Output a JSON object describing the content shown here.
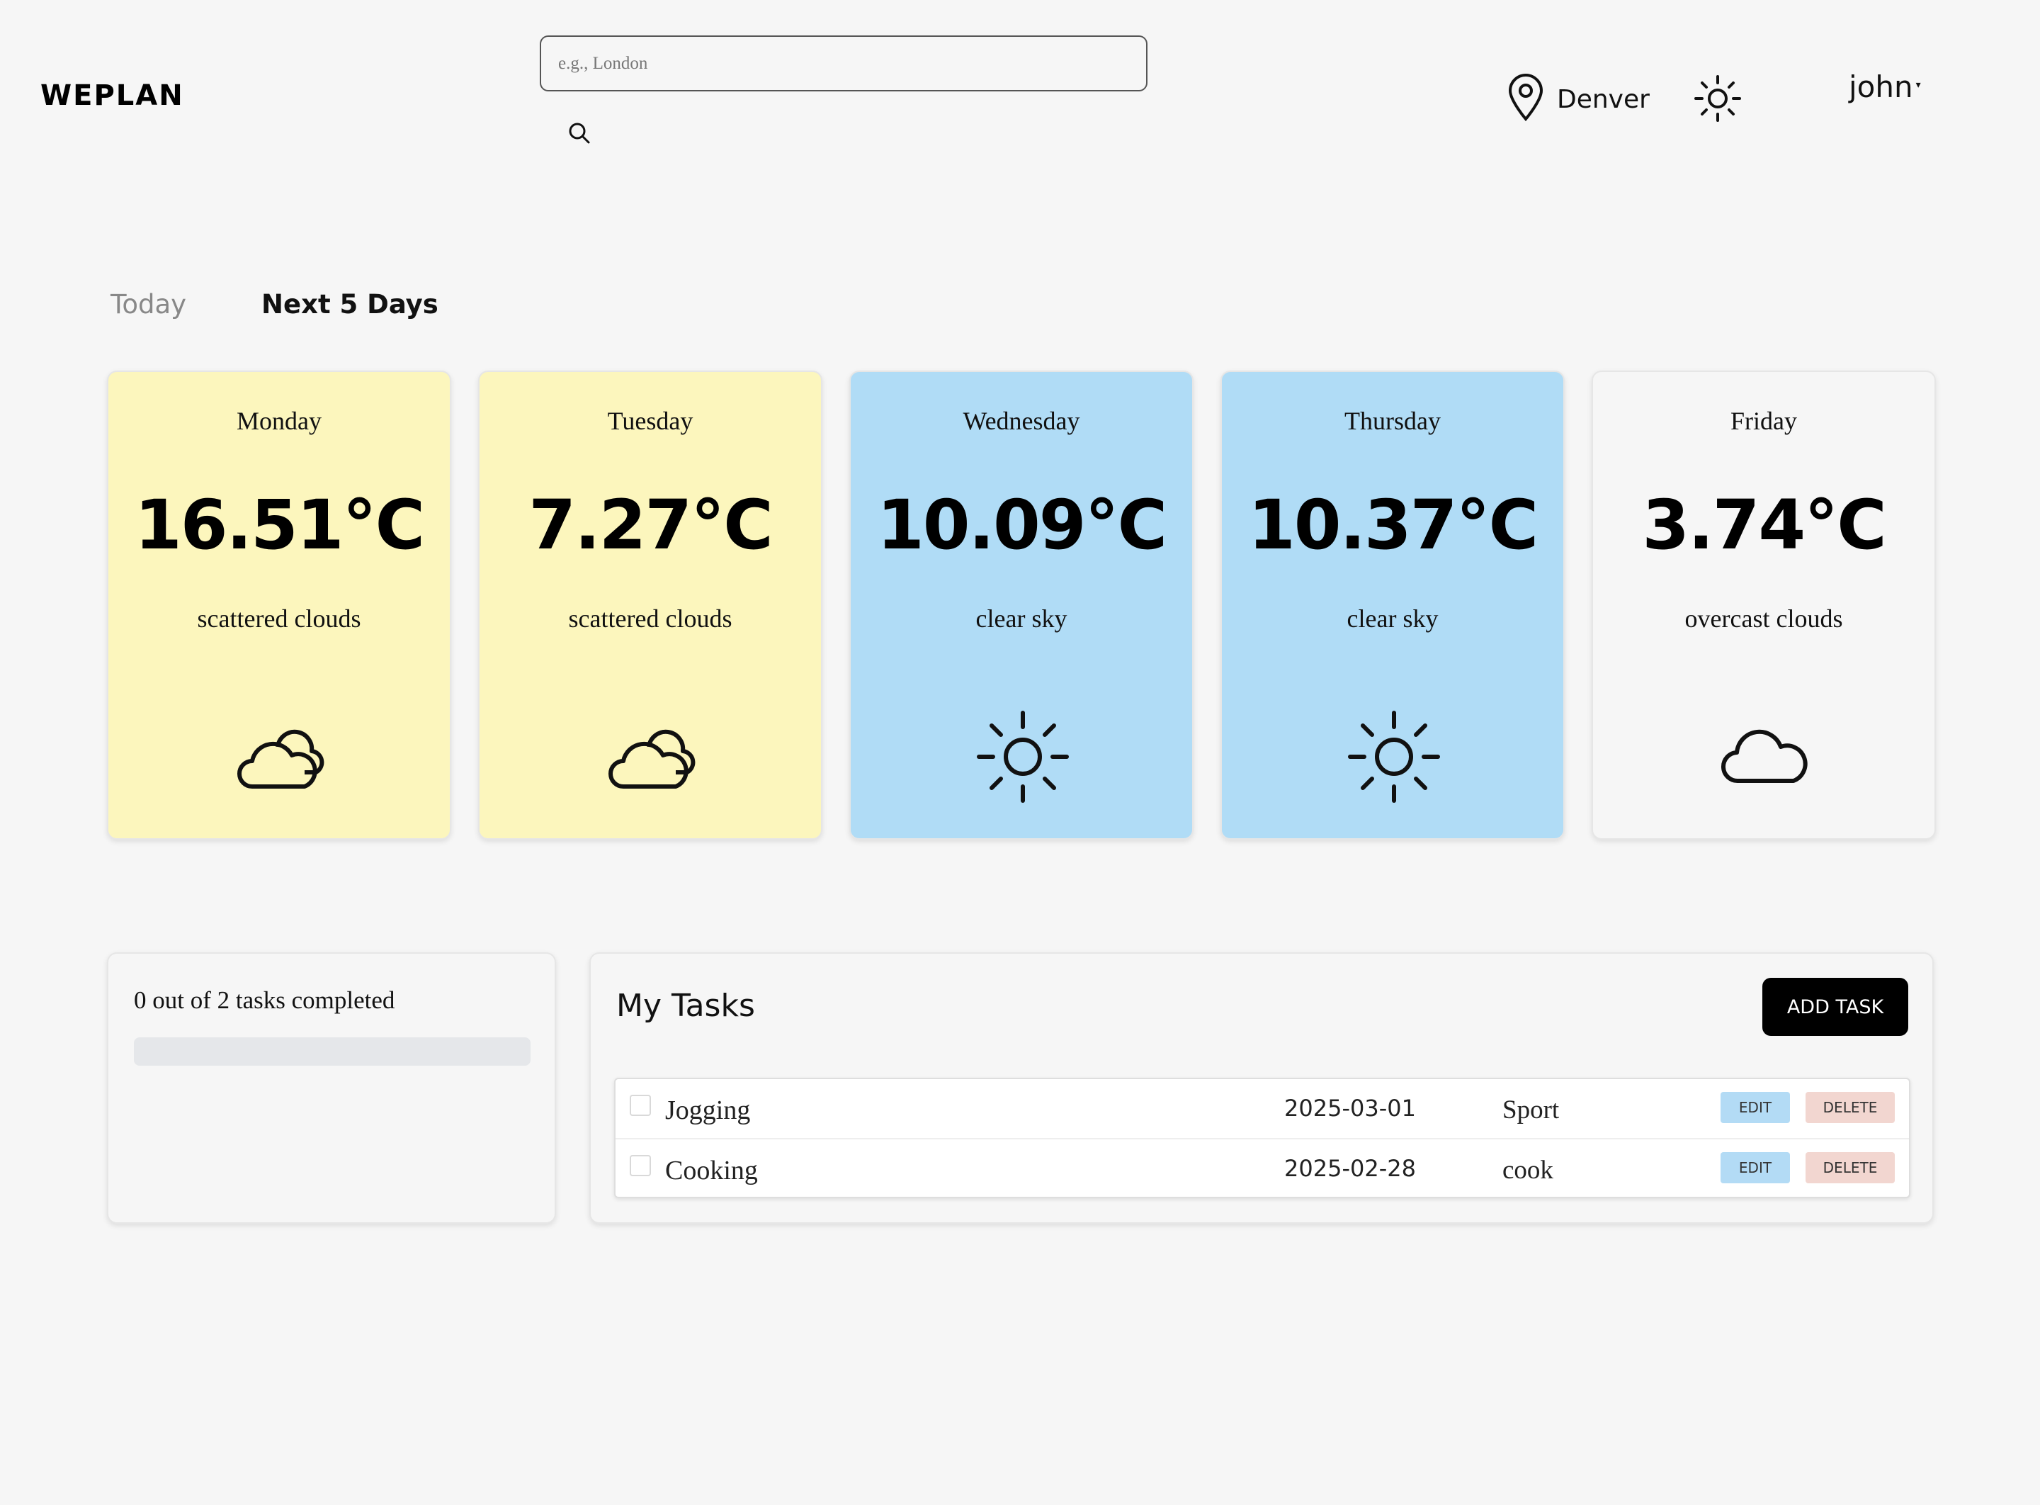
{
  "header": {
    "logo": "WEPLAN",
    "search": {
      "placeholder": "e.g., London",
      "value": ""
    },
    "location": "Denver",
    "user": "john"
  },
  "tabs": [
    {
      "label": "Today",
      "active": false
    },
    {
      "label": "Next 5 Days",
      "active": true
    }
  ],
  "forecast": [
    {
      "day": "Monday",
      "temp": "16.51°C",
      "desc": "scattered clouds",
      "icon": "clouds-icon",
      "bg": "#fcf6bd"
    },
    {
      "day": "Tuesday",
      "temp": "7.27°C",
      "desc": "scattered clouds",
      "icon": "clouds-icon",
      "bg": "#fcf6bd"
    },
    {
      "day": "Wednesday",
      "temp": "10.09°C",
      "desc": "clear sky",
      "icon": "sun-icon",
      "bg": "#b0dcf6"
    },
    {
      "day": "Thursday",
      "temp": "10.37°C",
      "desc": "clear sky",
      "icon": "sun-icon",
      "bg": "#b0dcf6"
    },
    {
      "day": "Friday",
      "temp": "3.74°C",
      "desc": "overcast clouds",
      "icon": "cloud-icon",
      "bg": "#f6f6f6"
    }
  ],
  "progress": {
    "label": "0 out of 2 tasks completed",
    "completed": 0,
    "total": 2
  },
  "tasks": {
    "title": "My Tasks",
    "add_label": "ADD TASK",
    "edit_label": "EDIT",
    "delete_label": "DELETE",
    "items": [
      {
        "name": "Jogging",
        "date": "2025-03-01",
        "category": "Sport",
        "done": false
      },
      {
        "name": "Cooking",
        "date": "2025-02-28",
        "category": "cook",
        "done": false
      }
    ]
  },
  "colors": {
    "sunny_card": "#b0dcf6",
    "cloudy_card": "#fcf6bd",
    "primary_button": "#000000",
    "edit_button": "#b3dbf5",
    "delete_button": "#f2d6d0"
  }
}
